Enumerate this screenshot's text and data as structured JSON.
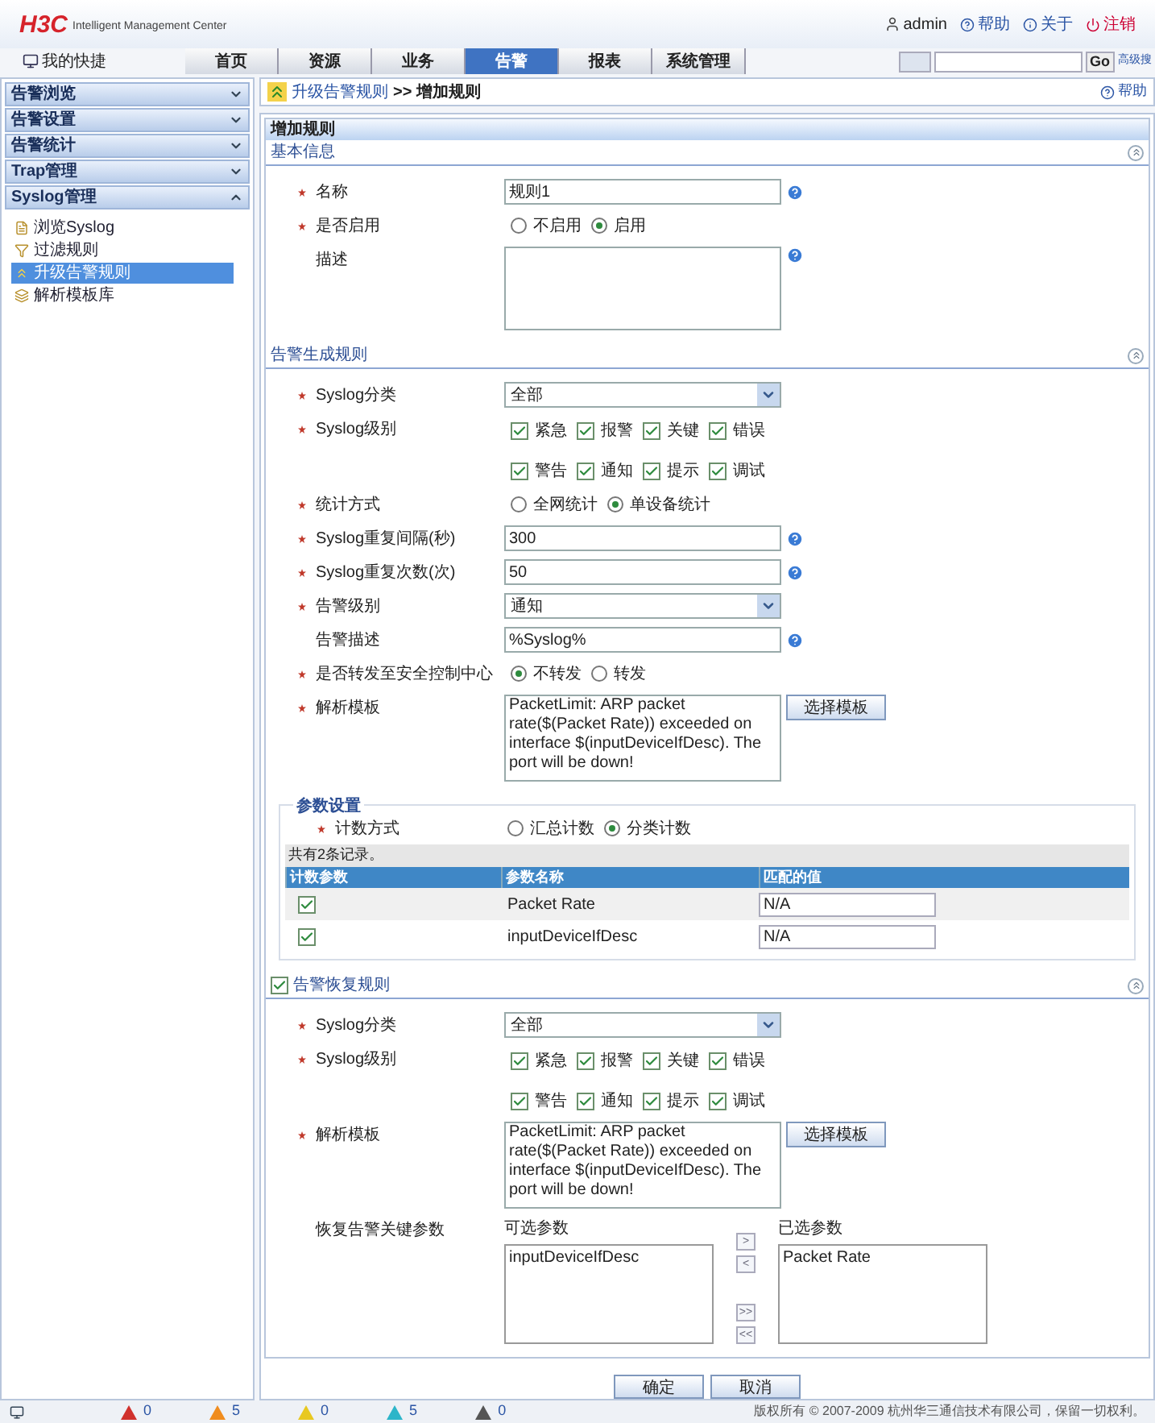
{
  "header": {
    "logo": "H3C",
    "logo_sub": "Intelligent Management Center",
    "user": "admin",
    "links": [
      "帮助",
      "关于",
      "注销"
    ]
  },
  "nav": {
    "shortcut": "我的快捷",
    "tabs": [
      {
        "label": "首页",
        "selected": false
      },
      {
        "label": "资源",
        "selected": false
      },
      {
        "label": "业务",
        "selected": false
      },
      {
        "label": "告警",
        "selected": true
      },
      {
        "label": "报表",
        "selected": false
      },
      {
        "label": "系统管理",
        "selected": false
      }
    ],
    "search_button": "Go",
    "search_link": "高级搜"
  },
  "sidebar": {
    "sections": [
      {
        "label": "告警浏览",
        "expanded": false
      },
      {
        "label": "告警设置",
        "expanded": false
      },
      {
        "label": "告警统计",
        "expanded": false
      },
      {
        "label": "Trap管理",
        "expanded": false
      },
      {
        "label": "Syslog管理",
        "expanded": true
      }
    ],
    "items": [
      {
        "label": "浏览Syslog",
        "selected": false
      },
      {
        "label": "过滤规则",
        "selected": false
      },
      {
        "label": "升级告警规则",
        "selected": true
      },
      {
        "label": "解析模板库",
        "selected": false
      }
    ]
  },
  "breadcrumb": {
    "parent": "升级告警规则",
    "separator": ">>",
    "current": "增加规则",
    "help": "帮助"
  },
  "form_title": "增加规则",
  "sections": [
    {
      "title": "基本信息",
      "rows": [
        {
          "kind": "text",
          "label": "名称",
          "required": true,
          "value": "规则1",
          "help": true
        },
        {
          "kind": "radio",
          "label": "是否启用",
          "required": true,
          "options": [
            {
              "label": "不启用",
              "selected": false
            },
            {
              "label": "启用",
              "selected": true
            }
          ]
        },
        {
          "kind": "textarea",
          "label": "描述",
          "required": false,
          "help": true
        }
      ]
    },
    {
      "title": "告警生成规则",
      "rows": [
        {
          "kind": "select",
          "label": "Syslog分类",
          "required": true,
          "value": "全部"
        },
        {
          "kind": "checks",
          "label": "Syslog级别",
          "required": true,
          "options": [
            {
              "label": "紧急",
              "checked": true
            },
            {
              "label": "报警",
              "checked": true
            },
            {
              "label": "关键",
              "checked": true
            },
            {
              "label": "错误",
              "checked": true
            },
            {
              "label": "警告",
              "checked": true
            },
            {
              "label": "通知",
              "checked": true
            },
            {
              "label": "提示",
              "checked": true
            },
            {
              "label": "调试",
              "checked": true
            }
          ]
        },
        {
          "kind": "radio",
          "label": "统计方式",
          "required": true,
          "options": [
            {
              "label": "全网统计",
              "selected": false
            },
            {
              "label": "单设备统计",
              "selected": true
            }
          ]
        },
        {
          "kind": "text",
          "label": "Syslog重复间隔(秒)",
          "required": true,
          "value": "300",
          "help": true
        },
        {
          "kind": "text",
          "label": "Syslog重复次数(次)",
          "required": true,
          "value": "50",
          "help": true
        },
        {
          "kind": "select",
          "label": "告警级别",
          "required": true,
          "value": "通知"
        },
        {
          "kind": "text",
          "label": "告警描述",
          "required": false,
          "value": "%Syslog%",
          "help": true
        },
        {
          "kind": "radio",
          "label": "是否转发至安全控制中心",
          "required": true,
          "options": [
            {
              "label": "不转发",
              "selected": true
            },
            {
              "label": "转发",
              "selected": false
            }
          ]
        },
        {
          "kind": "template",
          "label": "解析模板",
          "required": true,
          "value": "PacketLimit: ARP packet rate($(Packet Rate)) exceeded on interface $(inputDeviceIfDesc). The port will be down!",
          "button": "选择模板"
        }
      ],
      "params": {
        "title": "参数设置",
        "row": {
          "kind": "radio",
          "label": "计数方式",
          "required": true,
          "options": [
            {
              "label": "汇总计数",
              "selected": false
            },
            {
              "label": "分类计数",
              "selected": true
            }
          ]
        },
        "count": "共有2条记录。",
        "columns": [
          "计数参数",
          "参数名称",
          "匹配的值"
        ],
        "rows": [
          {
            "checked": true,
            "name": "Packet Rate",
            "value": "N/A"
          },
          {
            "checked": true,
            "name": "inputDeviceIfDesc",
            "value": "N/A"
          }
        ]
      }
    },
    {
      "title": "告警恢复规则",
      "checked": true,
      "rows": [
        {
          "kind": "select",
          "label": "Syslog分类",
          "required": true,
          "value": "全部"
        },
        {
          "kind": "checks",
          "label": "Syslog级别",
          "required": true,
          "options": [
            {
              "label": "紧急",
              "checked": true
            },
            {
              "label": "报警",
              "checked": true
            },
            {
              "label": "关键",
              "checked": true
            },
            {
              "label": "错误",
              "checked": true
            },
            {
              "label": "警告",
              "checked": true
            },
            {
              "label": "通知",
              "checked": true
            },
            {
              "label": "提示",
              "checked": true
            },
            {
              "label": "调试",
              "checked": true
            }
          ]
        },
        {
          "kind": "template",
          "label": "解析模板",
          "required": true,
          "value": "PacketLimit: ARP packet rate($(Packet Rate)) exceeded on interface $(inputDeviceIfDesc). The port will be down!",
          "button": "选择模板"
        },
        {
          "kind": "duallist",
          "label": "恢复告警关键参数",
          "required": false,
          "available_label": "可选参数",
          "available": [
            "inputDeviceIfDesc"
          ],
          "arrows": [
            ">",
            "<",
            ">>",
            "<<"
          ],
          "chosen_label": "已选参数",
          "chosen": [
            "Packet Rate"
          ]
        }
      ]
    }
  ],
  "buttons": [
    "确定",
    "取消"
  ],
  "status": {
    "alerts": [
      {
        "count": "0",
        "color": "#d0312d"
      },
      {
        "count": "5",
        "color": "#f08c1e"
      },
      {
        "count": "0",
        "color": "#e8c820"
      },
      {
        "count": "5",
        "color": "#2cb5c9"
      },
      {
        "count": "0",
        "color": "#555555"
      }
    ],
    "copyright": "版权所有 © 2007-2009 杭州华三通信技术有限公司，保留一切权利。"
  }
}
